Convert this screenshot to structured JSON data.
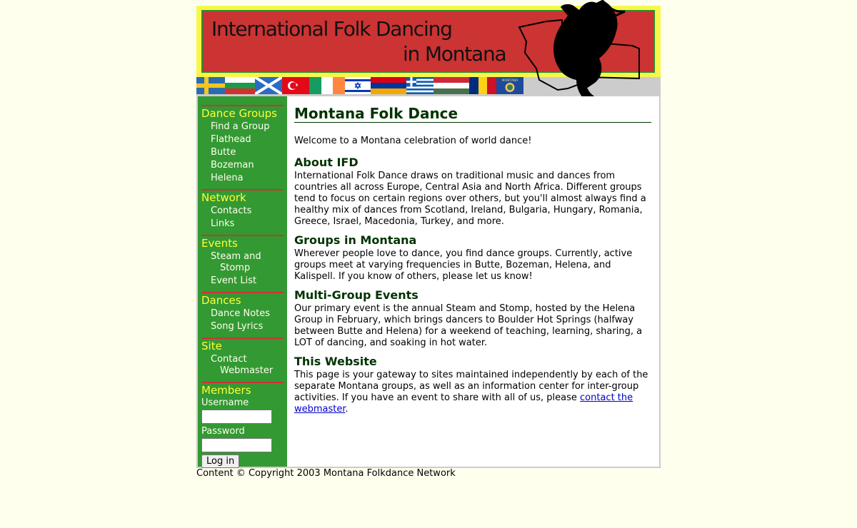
{
  "banner": {
    "title_line1": "International Folk Dancing",
    "title_line2": "in Montana"
  },
  "flags": [
    {
      "name": "sweden-flag-icon"
    },
    {
      "name": "bulgaria-flag-icon"
    },
    {
      "name": "scotland-flag-icon"
    },
    {
      "name": "turkey-flag-icon"
    },
    {
      "name": "ireland-flag-icon"
    },
    {
      "name": "israel-flag-icon"
    },
    {
      "name": "armenia-flag-icon"
    },
    {
      "name": "greece-flag-icon"
    },
    {
      "name": "hungary-flag-icon"
    },
    {
      "name": "romania-flag-icon"
    },
    {
      "name": "montana-flag-icon",
      "label": "MONTANA"
    }
  ],
  "sidebar": {
    "dance_groups": {
      "heading": "Dance Groups",
      "items": [
        "Find a Group",
        "Flathead",
        "Butte",
        "Bozeman",
        "Helena"
      ]
    },
    "network": {
      "heading": "Network",
      "items": [
        "Contacts",
        "Links"
      ]
    },
    "events": {
      "heading": "Events",
      "items": [
        "Steam and",
        "Stomp",
        "Event List"
      ]
    },
    "dances": {
      "heading": "Dances",
      "items": [
        "Dance Notes",
        "Song Lyrics"
      ]
    },
    "site": {
      "heading": "Site",
      "items": [
        "Contact",
        "Webmaster"
      ]
    },
    "members": {
      "heading": "Members",
      "username_label": "Username",
      "password_label": "Password",
      "login_button": "Log in"
    }
  },
  "content": {
    "title": "Montana Folk Dance",
    "welcome": "Welcome to a Montana celebration of world dance!",
    "sections": [
      {
        "heading": "About IFD",
        "text": "International Folk Dance draws on traditional music and dances from countries all across Europe, Central Asia and North Africa. Different groups tend to focus on certain regions over others, but you'll almost always find a healthy mix of dances from Scotland, Ireland, Bulgaria, Hungary, Romania, Greece, Israel, Macedonia, Turkey, and more."
      },
      {
        "heading": "Groups in Montana",
        "text": "Wherever people love to dance, you find dance groups. Currently, active groups meet at varying frequencies in Butte, Bozeman, Helena, and Kalispell. If you know of others, please let us know!"
      },
      {
        "heading": "Multi-Group Events",
        "text": "Our primary event is the annual Steam and Stomp, hosted by the Helena Group in February, which brings dancers to Boulder Hot Springs (halfway between Butte and Helena) for a weekend of teaching, learning, sharing, a LOT of dancing, and soaking in hot water."
      },
      {
        "heading": "This Website",
        "text_before": "This page is your gateway to sites maintained independently by each of the separate Montana groups, as well as an information center for inter-group activities. If you have an event to share with all of us, please ",
        "link_text": "contact the webmaster",
        "text_after": "."
      }
    ]
  },
  "footer": {
    "text": "Content © Copyright 2003 Montana Folkdance Network"
  },
  "colors": {
    "page_bg": "#ffffee",
    "banner_yellow": "#f7f74a",
    "banner_red": "#cc3333",
    "sidebar_green": "#339933",
    "heading_yellow": "#ffff33",
    "heading_dark_green": "#003300",
    "link_blue": "#0000cc"
  }
}
